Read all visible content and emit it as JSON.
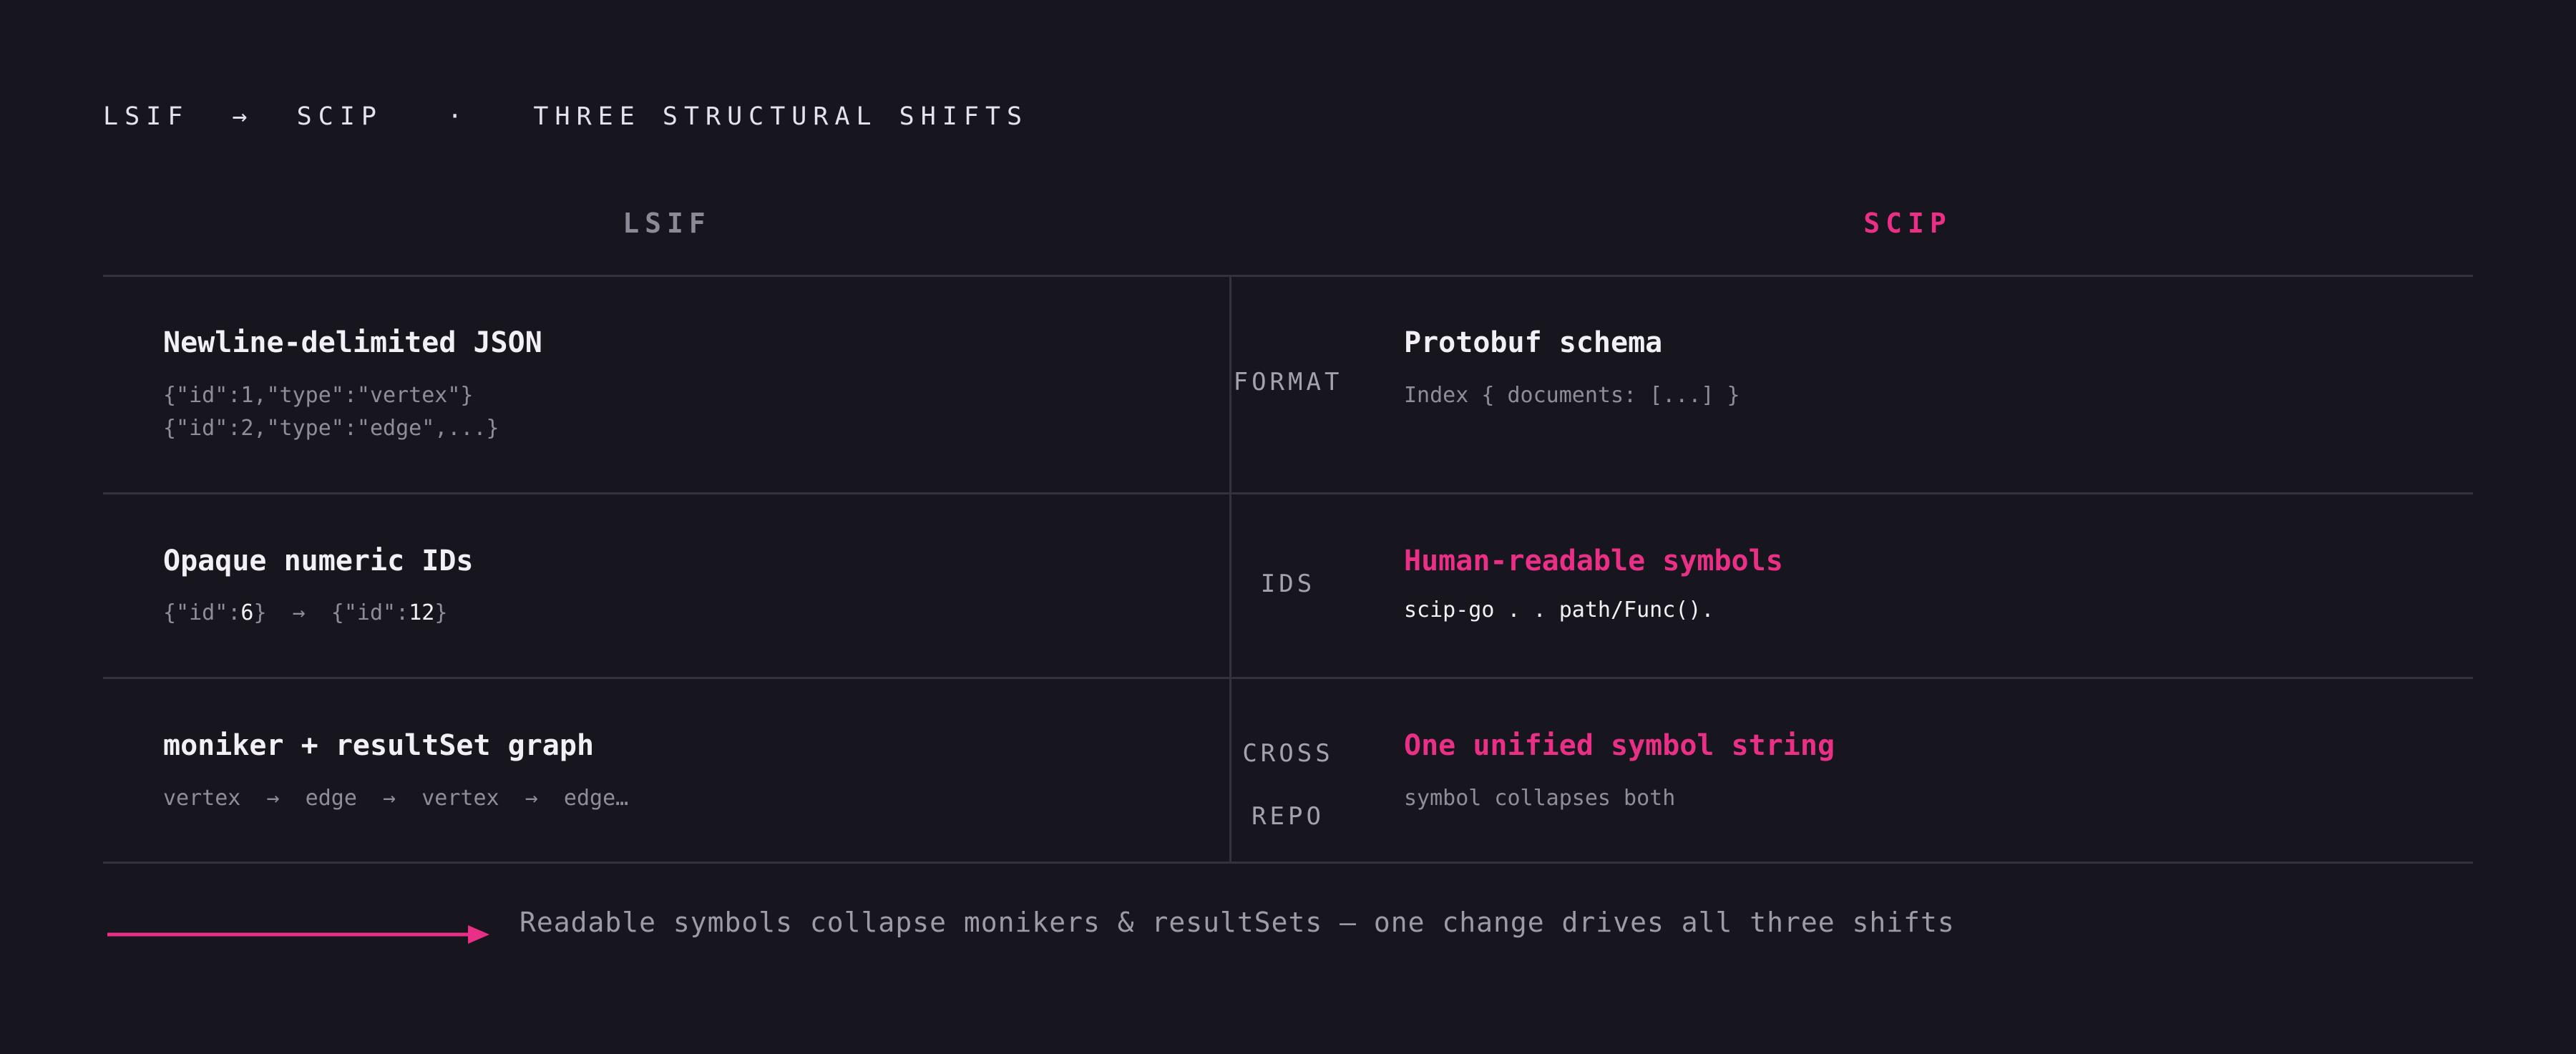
{
  "kicker": "LSIF  →  SCIP   ·   THREE STRUCTURAL SHIFTS",
  "columns": {
    "left": "LSIF",
    "right": "SCIP"
  },
  "rows": [
    {
      "label": "FORMAT",
      "lsif_title": "Newline-delimited JSON",
      "lsif_lines": [
        "{\"id\":1,\"type\":\"vertex\"}",
        "{\"id\":2,\"type\":\"edge\",...}"
      ],
      "scip_title": "Protobuf schema",
      "scip_sub": "Index { documents: [...] }"
    },
    {
      "label": "IDS",
      "lsif_title": "Opaque numeric IDs",
      "lsif_sub_parts": [
        "{\"id\":",
        "6",
        "}  →  {\"id\":",
        "12",
        "}"
      ],
      "scip_title": "Human-readable symbols",
      "scip_sub": "scip-go . . path/Func()."
    },
    {
      "label_lines": [
        "CROSS",
        "REPO"
      ],
      "lsif_title": "moniker + resultSet graph",
      "lsif_sub": "vertex  →  edge  →  vertex  →  edge…",
      "scip_title": "One unified symbol string",
      "scip_sub": "symbol collapses both"
    }
  ],
  "caption": "Readable symbols collapse monikers & resultSets — one change drives all three shifts",
  "colors": {
    "background": "#17161f",
    "accent": "#ea2f86",
    "rule": "#34333d",
    "muted": "#8f8d99"
  }
}
